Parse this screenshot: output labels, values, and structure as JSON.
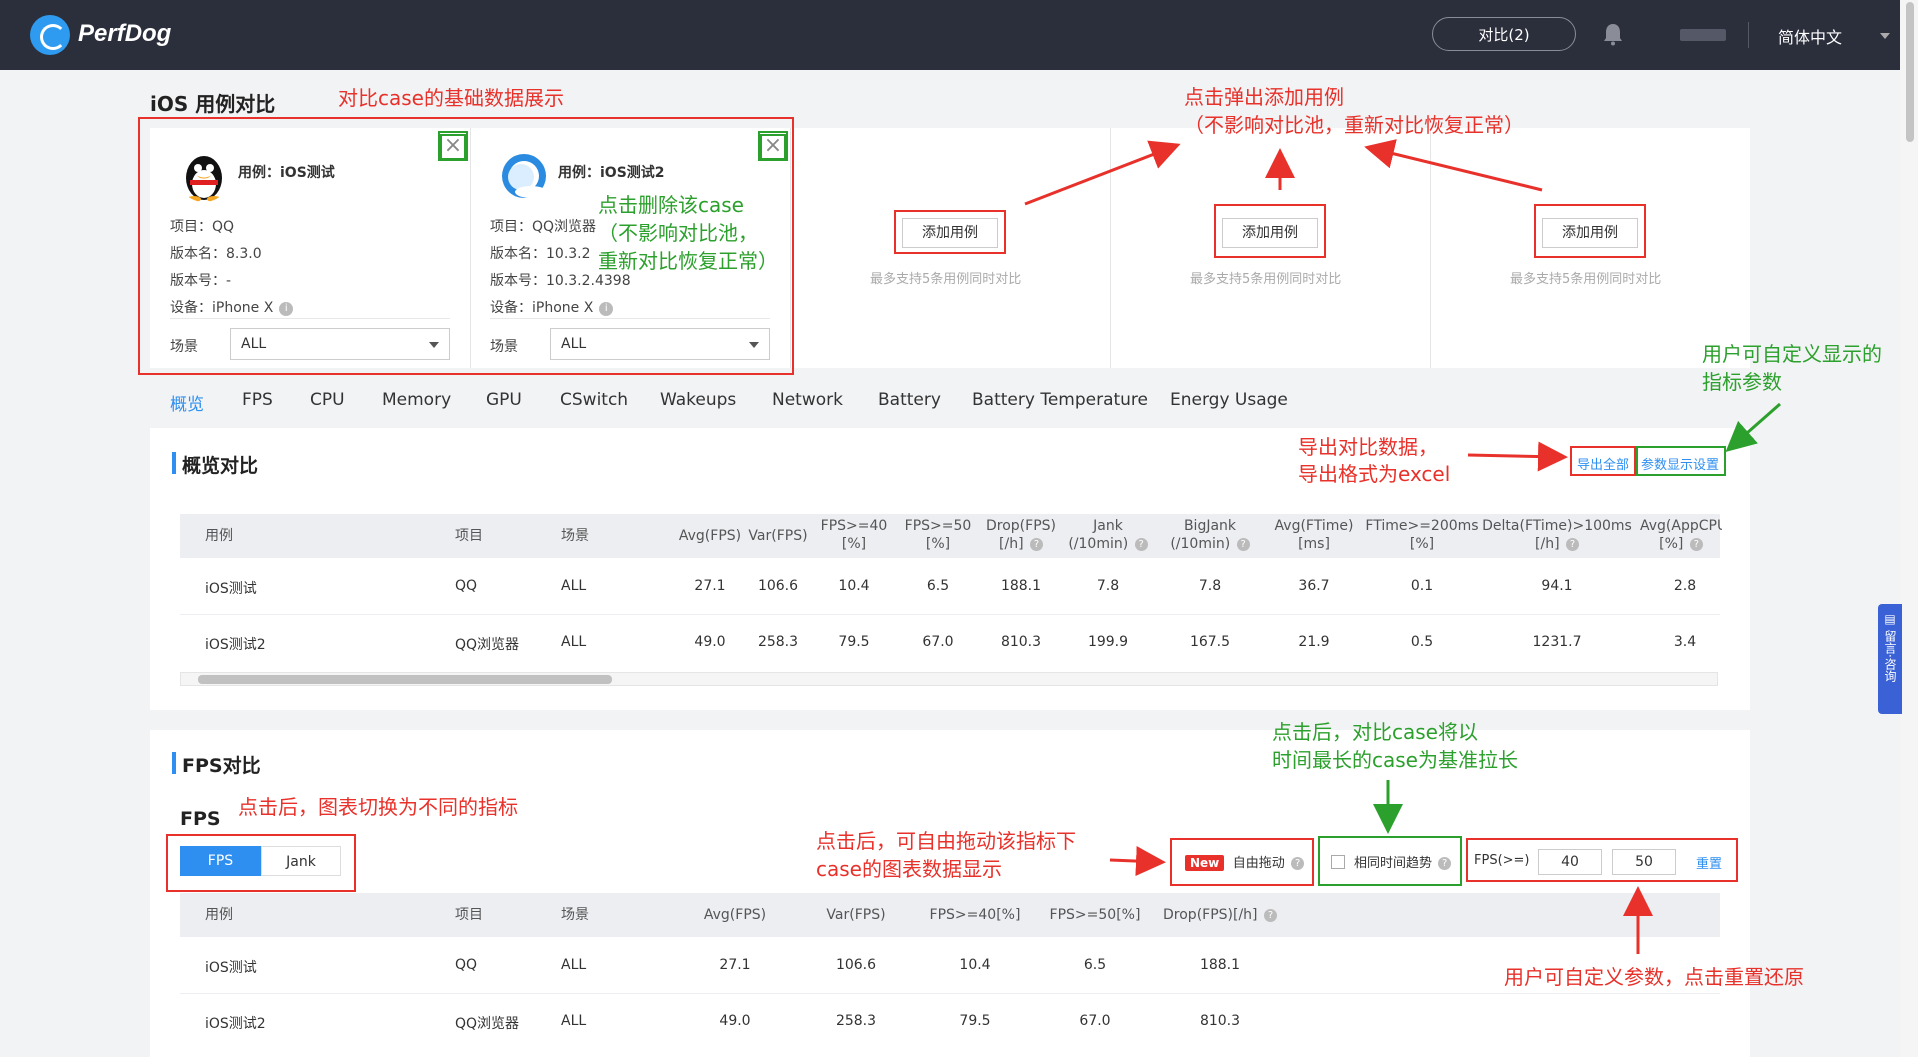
{
  "app": {
    "name": "PerfDog",
    "compare_label": "对比(2)",
    "language": "简体中文"
  },
  "page_title": "iOS 用例对比",
  "cases": [
    {
      "name": "用例：iOS测试",
      "project": "项目：QQ",
      "version_name": "版本名：8.3.0",
      "version_code": "版本号：-",
      "device": "设备：iPhone X",
      "scene_label": "场景",
      "scene_value": "ALL"
    },
    {
      "name": "用例：iOS测试2",
      "project": "项目：QQ浏览器",
      "version_name": "版本名：10.3.2",
      "version_code": "版本号：10.3.2.4398",
      "device": "设备：iPhone X",
      "scene_label": "场景",
      "scene_value": "ALL"
    }
  ],
  "add_slots": [
    {
      "button": "添加用例",
      "hint": "最多支持5条用例同时对比"
    },
    {
      "button": "添加用例",
      "hint": "最多支持5条用例同时对比"
    },
    {
      "button": "添加用例",
      "hint": "最多支持5条用例同时对比"
    }
  ],
  "tabs": [
    "概览",
    "FPS",
    "CPU",
    "Memory",
    "GPU",
    "CSwitch",
    "Wakeups",
    "Network",
    "Battery",
    "Battery Temperature",
    "Energy Usage"
  ],
  "overview": {
    "title": "概览对比",
    "export_all": "导出全部",
    "param_settings": "参数显示设置",
    "columns": [
      "用例",
      "项目",
      "场景",
      "Avg(FPS)",
      "Var(FPS)",
      "FPS>=40\n[%]",
      "FPS>=50\n[%]",
      "Drop(FPS)\n[/h]",
      "Jank\n(/10min)",
      "BigJank\n(/10min)",
      "Avg(FTime)\n[ms]",
      "FTime>=200ms\n[%]",
      "Delta(FTime)>100ms\n[/h]",
      "Avg(AppCPU\n[%]"
    ],
    "rows": [
      [
        "iOS测试",
        "QQ",
        "ALL",
        "27.1",
        "106.6",
        "10.4",
        "6.5",
        "188.1",
        "7.8",
        "7.8",
        "36.7",
        "0.1",
        "94.1",
        "2.8"
      ],
      [
        "iOS测试2",
        "QQ浏览器",
        "ALL",
        "49.0",
        "258.3",
        "79.5",
        "67.0",
        "810.3",
        "199.9",
        "167.5",
        "21.9",
        "0.5",
        "1231.7",
        "3.4"
      ]
    ]
  },
  "fps_section": {
    "title": "FPS对比",
    "subtitle": "FPS",
    "segments": [
      "FPS",
      "Jank"
    ],
    "new_badge": "New",
    "free_drag": "自由拖动",
    "same_time_trend": "相同时间趋势",
    "fps_ge_label": "FPS(>=)",
    "threshold_1": "40",
    "threshold_2": "50",
    "reset": "重置",
    "columns": [
      "用例",
      "项目",
      "场景",
      "Avg(FPS)",
      "Var(FPS)",
      "FPS>=40[%]",
      "FPS>=50[%]",
      "Drop(FPS)[/h]"
    ],
    "rows": [
      [
        "iOS测试",
        "QQ",
        "ALL",
        "27.1",
        "106.6",
        "10.4",
        "6.5",
        "188.1"
      ],
      [
        "iOS测试2",
        "QQ浏览器",
        "ALL",
        "49.0",
        "258.3",
        "79.5",
        "67.0",
        "810.3"
      ]
    ]
  },
  "annotations": {
    "case_data": "对比case的基础数据展示",
    "add_case": "点击弹出添加用例",
    "add_case_note": "（不影响对比池，重新对比恢复正常）",
    "delete_case": "点击删除该case",
    "delete_case_note1": "（不影响对比池，",
    "delete_case_note2": "重新对比恢复正常）",
    "custom_params1": "用户可自定义显示的",
    "custom_params2": "指标参数",
    "export1": "导出对比数据，",
    "export2": "导出格式为excel",
    "same_time1": "点击后，对比case将以",
    "same_time2": "时间最长的case为基准拉长",
    "switch_metric": "点击后，图表切换为不同的指标",
    "drag1": "点击后，可自由拖动该指标下",
    "drag2": "case的图表数据显示",
    "reset_note": "用户可自定义参数，点击重置还原"
  },
  "side_float": "留言·咨询",
  "colors": {
    "accent": "#2f8ff0",
    "annotation_red": "#e8312a",
    "annotation_green": "#2ca02c",
    "topbar": "#2b2e3b"
  }
}
